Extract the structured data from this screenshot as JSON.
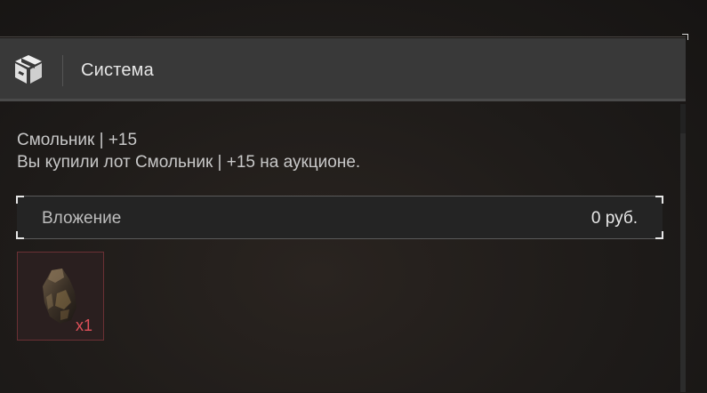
{
  "header": {
    "icon": "package-box-icon",
    "title": "Система"
  },
  "message": {
    "line1": "Смольник | +15",
    "line2": "Вы купили лот Смольник | +15 на аукционе."
  },
  "attachment": {
    "label": "Вложение",
    "value": "0 руб."
  },
  "items": [
    {
      "icon": "ore-chunk-icon",
      "count": "x1"
    }
  ],
  "colors": {
    "header_bg": "#393939",
    "count_red": "#e0505a",
    "slot_border": "#6b3034"
  }
}
